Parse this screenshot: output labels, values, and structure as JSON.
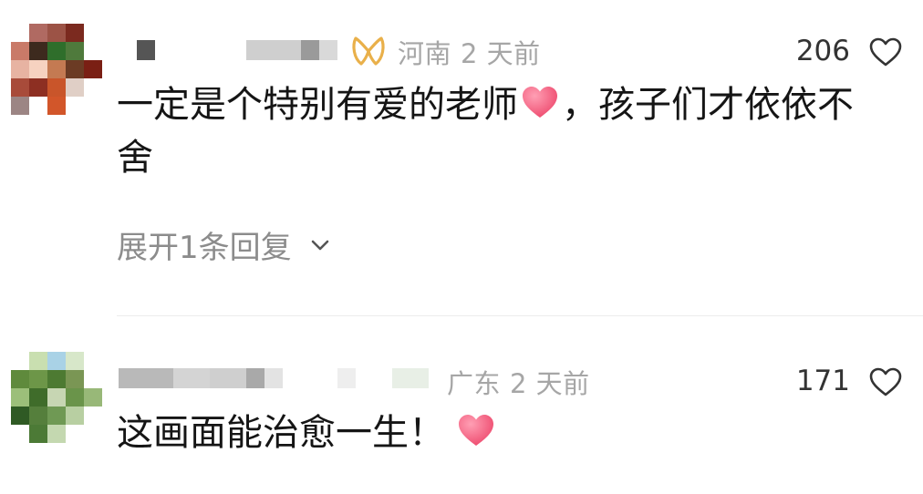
{
  "comments": [
    {
      "location": "河南",
      "time": "2 天前",
      "likes": "206",
      "text_part1": "一定是个特别有爱的老师",
      "text_part2": "，孩子们才依依不舍",
      "expand_label": "展开1条回复",
      "badge_icon": "vip-ribbon-icon",
      "avatar_colors": [
        [
          "#ffffff",
          "#b06a62",
          "#9c5346",
          "#7b2a1f",
          "#ffffff"
        ],
        [
          "#c97a68",
          "#3d2a1e",
          "#2f6e2b",
          "#4f7a3c",
          "#ffffff"
        ],
        [
          "#e7b3a2",
          "#f6d2c0",
          "#c47a52",
          "#6b3b24",
          "#7a1f14"
        ],
        [
          "#a84b3a",
          "#8d2f22",
          "#c9552a",
          "#e0cfc6",
          "#ffffff"
        ],
        [
          "#9c8584",
          "#ffffff",
          "#d2562a",
          "#ffffff",
          "#ffffff"
        ]
      ]
    },
    {
      "location": "广东",
      "time": "2 天前",
      "likes": "171",
      "text_part1": "这画面能治愈一生！",
      "avatar_colors": [
        [
          "#ffffff",
          "#c9dfb0",
          "#a9d2e6",
          "#d7e7c9",
          "#ffffff"
        ],
        [
          "#5f8a3c",
          "#6d9648",
          "#4d7a32",
          "#7a9654",
          "#ffffff"
        ],
        [
          "#9cbf7a",
          "#3f6c2a",
          "#c7d6b3",
          "#6a944a",
          "#98b878"
        ],
        [
          "#2f5a24",
          "#557f3c",
          "#6f9954",
          "#b8cfa2",
          "#ffffff"
        ],
        [
          "#ffffff",
          "#4c7a36",
          "#c4d8b0",
          "#ffffff",
          "#ffffff"
        ]
      ]
    }
  ],
  "colors": {
    "heart": "#f05a7a",
    "meta": "#a6a6a6",
    "badge": "#e9b04a"
  }
}
